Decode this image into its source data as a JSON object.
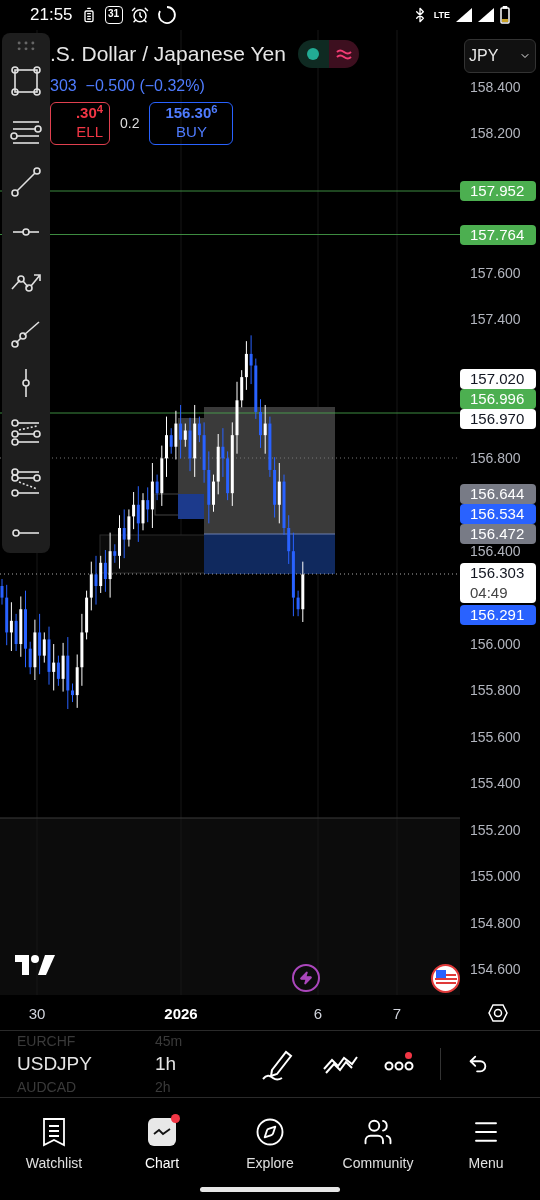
{
  "status_bar": {
    "time": "21:55",
    "calendar_day": "31",
    "network": "LTE"
  },
  "header": {
    "title": ".S. Dollar / Japanese Yen",
    "change": "303  −0.500 (−0.32%)",
    "sell": {
      "price": ".30$^{4}$",
      "label": "ELL"
    },
    "spread": "0.2",
    "buy": {
      "price": "156.30$^{6}$",
      "label": "BUY"
    },
    "market_open": true,
    "currency": "JPY"
  },
  "price_axis": {
    "ticks": [
      "158.400",
      "158.200",
      "157.600",
      "157.400",
      "156.800",
      "156.400",
      "156.000",
      "155.800",
      "155.600",
      "155.400",
      "155.200",
      "155.000",
      "154.800",
      "154.600"
    ],
    "markers": [
      {
        "price": "157.952",
        "color": "#4caf50",
        "kind": "level"
      },
      {
        "price": "157.764",
        "color": "#4caf50",
        "kind": "level"
      },
      {
        "price": "157.020",
        "color": "#ffffff",
        "kind": "level"
      },
      {
        "price": "156.996",
        "color": "#4caf50",
        "kind": "level"
      },
      {
        "price": "156.970",
        "color": "#ffffff",
        "kind": "level"
      },
      {
        "price": "156.644",
        "color": "#787b86",
        "kind": "level"
      },
      {
        "price": "156.534",
        "color": "#2962ff",
        "kind": "level"
      },
      {
        "price": "156.472",
        "color": "#787b86",
        "kind": "level"
      },
      {
        "price": "156.303",
        "color": "#ffffff",
        "kind": "current",
        "countdown": "04:49"
      },
      {
        "price": "156.291",
        "color": "#2962ff",
        "kind": "level"
      }
    ]
  },
  "time_axis": [
    {
      "label": "30",
      "emphasized": false
    },
    {
      "label": "2026",
      "emphasized": true
    },
    {
      "label": "6",
      "emphasized": false
    },
    {
      "label": "7",
      "emphasized": false
    }
  ],
  "symbol_picker": [
    {
      "symbol": "EURCHF",
      "interval": "45m",
      "selected": false
    },
    {
      "symbol": "USDJPY",
      "interval": "1h",
      "selected": true
    },
    {
      "symbol": "AUDCAD",
      "interval": "2h",
      "selected": false
    }
  ],
  "toolbar": {
    "more_badge": true
  },
  "nav": [
    {
      "label": "Watchlist",
      "selected": false,
      "badge": false
    },
    {
      "label": "Chart",
      "selected": true,
      "badge": true
    },
    {
      "label": "Explore",
      "selected": false,
      "badge": false
    },
    {
      "label": "Community",
      "selected": false,
      "badge": false
    },
    {
      "label": "Menu",
      "selected": false,
      "badge": false
    }
  ]
}
